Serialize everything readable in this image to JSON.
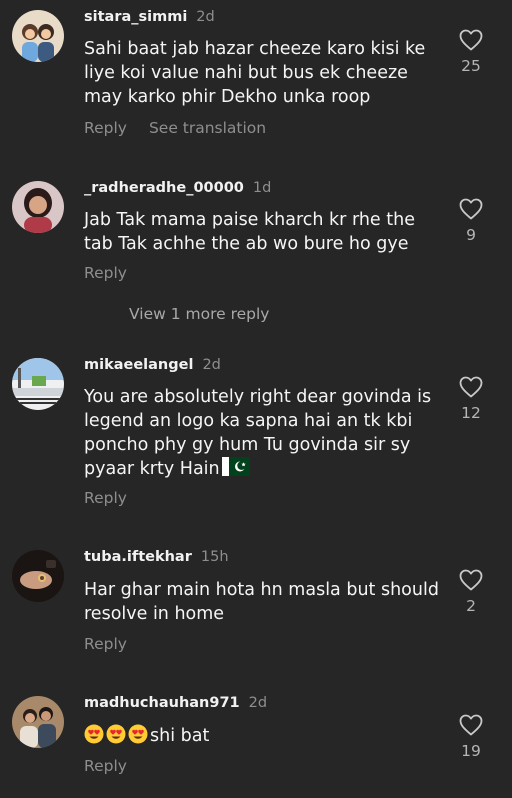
{
  "comments": [
    {
      "username": "sitara_simmi",
      "time": "2d",
      "text": "Sahi baat jab hazar cheeze karo kisi ke liye koi value nahi but bus ek cheeze may karko phir Dekho unka roop",
      "like_count": "25",
      "reply_label": "Reply",
      "translate_label": "See translation"
    },
    {
      "username": "_radheradhe_00000",
      "time": "1d",
      "text": "Jab Tak mama paise kharch kr rhe the tab Tak achhe the ab wo bure ho gye",
      "like_count": "9",
      "reply_label": "Reply",
      "view_more_label": "View 1 more reply"
    },
    {
      "username": "mikaeelangel",
      "time": "2d",
      "text": "You are absolutely right dear govinda is legend an logo ka sapna hai an tk kbi poncho phy gy hum Tu govinda sir sy pyaar krty Hain",
      "flag_icon": "pakistan-flag-emoji",
      "like_count": "12",
      "reply_label": "Reply"
    },
    {
      "username": "tuba.iftekhar",
      "time": "15h",
      "text": "Har ghar main hota hn masla but should resolve in home",
      "like_count": "2",
      "reply_label": "Reply"
    },
    {
      "username": "madhuchauhan971",
      "time": "2d",
      "emoji_icons": [
        "heart-eyes-emoji",
        "heart-eyes-emoji",
        "heart-eyes-emoji"
      ],
      "text": "shi bat",
      "like_count": "19",
      "reply_label": "Reply"
    }
  ],
  "colors": {
    "background": "#262626",
    "primary_text": "#f5f5f5",
    "secondary_text": "#8e8e8e"
  },
  "icons": {
    "like": "heart-outline-icon"
  }
}
